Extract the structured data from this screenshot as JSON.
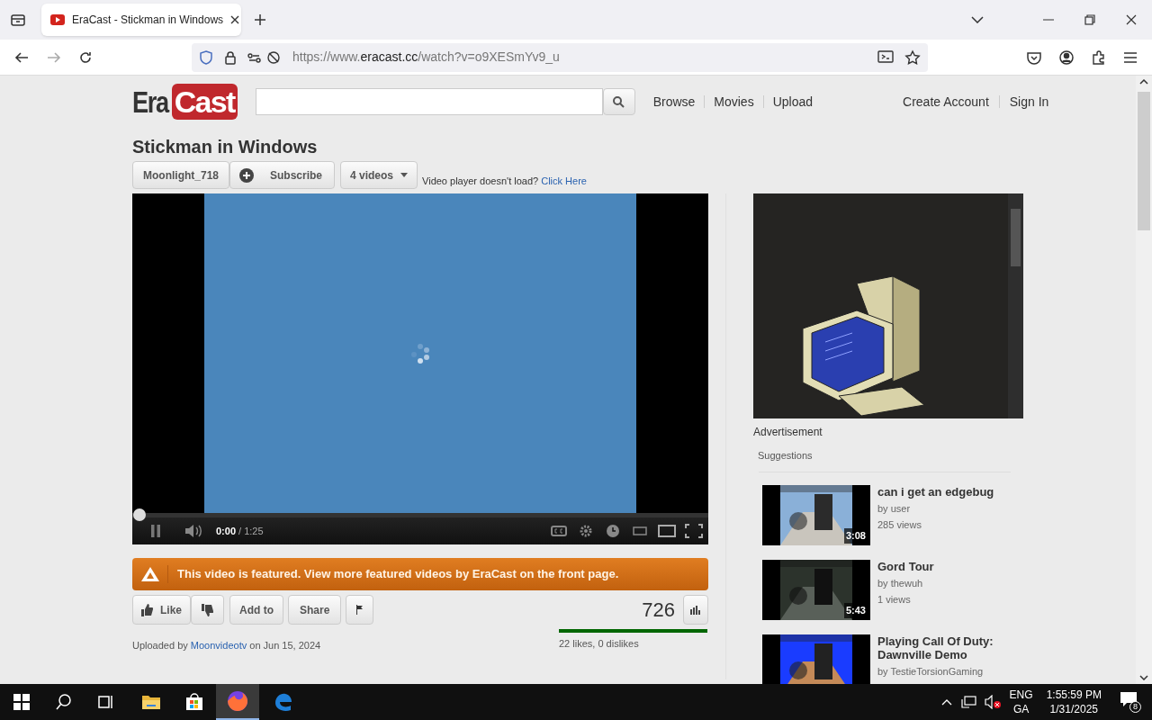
{
  "browser": {
    "tab_title": "EraCast - Stickman in Windows",
    "url": "https://www.**eracast.cc**/watch?v=o9XESmYv9_u"
  },
  "header": {
    "logo_left": "Era",
    "logo_right": "Cast",
    "nav": [
      "Browse",
      "Movies",
      "Upload"
    ],
    "account": [
      "Create Account",
      "Sign In"
    ]
  },
  "video": {
    "title": "Stickman in Windows",
    "channel": "Moonlight_718",
    "subscribe": "Subscribe",
    "videos": "4 videos",
    "load_notice": "Video player doesn't load?",
    "load_link": "Click Here"
  },
  "player": {
    "playing": true,
    "level": 0,
    "current_time": "0:00",
    "duration": "/ 1:25"
  },
  "banner": "This video is featured. View more featured videos by EraCast on the front page.",
  "actions": {
    "like": "Like",
    "add_to": "Add to",
    "share": "Share",
    "view_count": "726"
  },
  "upload": {
    "prefix": "Uploaded by",
    "uploader": "Moonvideotv",
    "suffix": "on Jun 15, 2024"
  },
  "rating": {
    "level": 1,
    "text": "22 likes, 0 dislikes"
  },
  "ad_label": "Advertisement",
  "suggestions_heading": "Suggestions",
  "suggestions": [
    {
      "title": "can i get an edgebug",
      "by": "by user",
      "views": "285 views",
      "duration": "3:08"
    },
    {
      "title": "Gord Tour",
      "by": "by thewuh",
      "views": "1 views",
      "duration": "5:43"
    },
    {
      "title": "Playing Call Of Duty: Dawnville Demo",
      "by": "by TestieTorsionGaming"
    }
  ],
  "taskbar": {
    "lang": "ENG",
    "layout": "GA",
    "time": "1:55:59 PM",
    "date": "1/31/2025",
    "notifications": "8"
  }
}
